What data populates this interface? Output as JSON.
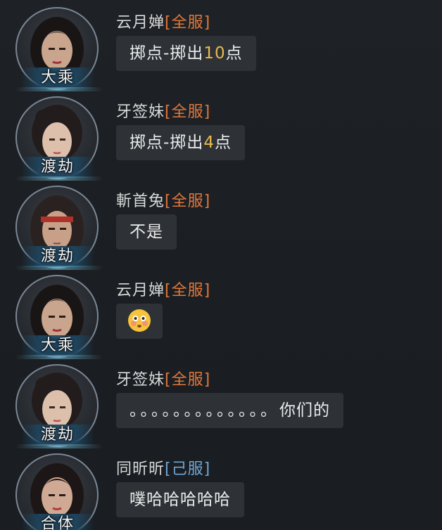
{
  "messages": [
    {
      "sender": "云月婵",
      "server": "[全服]",
      "rank": "大乘",
      "text_parts": [
        "掷点-掷出",
        "10",
        "点"
      ]
    },
    {
      "sender": "牙签妹",
      "server": "[全服]",
      "rank": "渡劫",
      "text_parts": [
        "掷点-掷出",
        "4",
        "点"
      ]
    },
    {
      "sender": "斬首兔",
      "server": "[全服]",
      "rank": "渡劫",
      "text": "不是"
    },
    {
      "sender": "云月婵",
      "server": "[全服]",
      "rank": "大乘",
      "emoji": "flushed-face-emoji"
    },
    {
      "sender": "牙签妹",
      "server": "[全服]",
      "rank": "渡劫",
      "dots": "。。。。。。。。。。。。。",
      "text": "你们的"
    },
    {
      "sender": "同昕昕",
      "server": "[己服]",
      "rank": "合体",
      "text": "噗哈哈哈哈哈"
    }
  ],
  "colors": {
    "server_all": "#e0773a",
    "server_own": "#6fa6d6",
    "highlight_number": "#e9b94a",
    "bubble_bg": "#2e3237",
    "background": "#1c2024"
  }
}
